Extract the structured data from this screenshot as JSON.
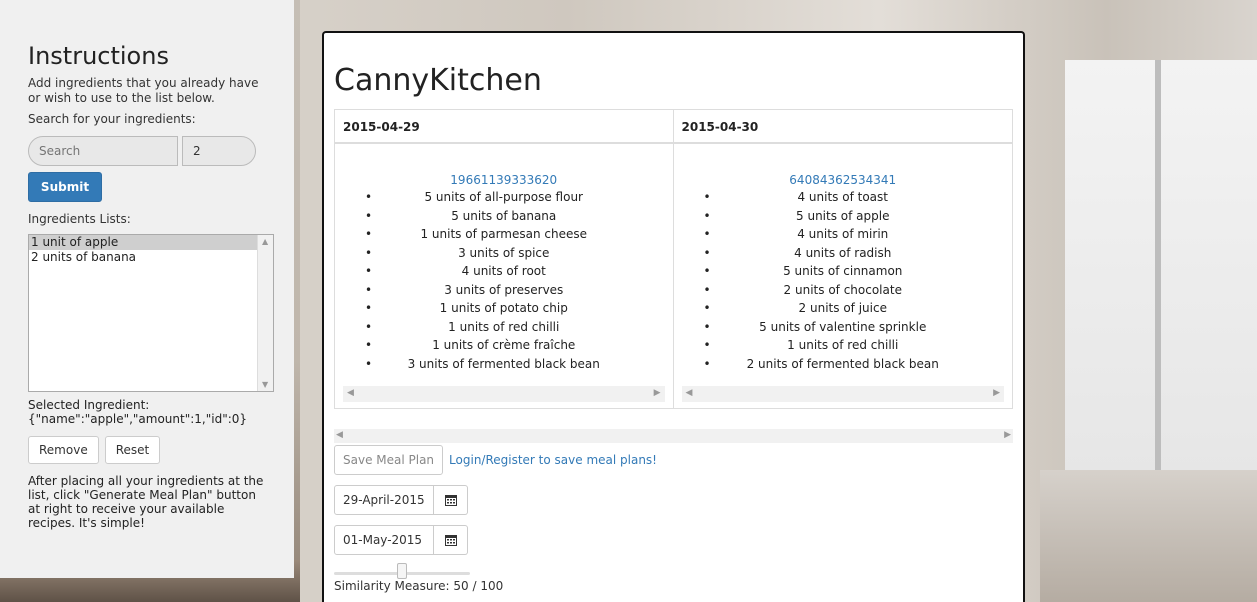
{
  "sidebar": {
    "title": "Instructions",
    "intro": "Add ingredients that you already have or wish to use to the list below.",
    "search_label": "Search for your ingredients:",
    "search_placeholder": "Search",
    "amount_value": "2",
    "submit_label": "Submit",
    "lists_label": "Ingredients Lists:",
    "ingredients": [
      "1 unit of apple",
      "2 units of banana"
    ],
    "selected_label": "Selected Ingredient:",
    "selected_value": "{\"name\":\"apple\",\"amount\":1,\"id\":0}",
    "remove_label": "Remove",
    "reset_label": "Reset",
    "after_text": "After placing all your ingredients at the list, click \"Generate Meal Plan\" button at right to receive your available recipes. It's simple!"
  },
  "main": {
    "title": "CannyKitchen",
    "days": [
      {
        "date": "2015-04-29",
        "recipe_id": "19661139333620",
        "items": [
          "5 units of all-purpose flour",
          "5 units of banana",
          "1 units of parmesan cheese",
          "3 units of spice",
          "4 units of root",
          "3 units of preserves",
          "1 units of potato chip",
          "1 units of red chilli",
          "1 units of crème fraîche",
          "3 units of fermented black bean"
        ]
      },
      {
        "date": "2015-04-30",
        "recipe_id": "64084362534341",
        "items": [
          "4 units of toast",
          "5 units of apple",
          "4 units of mirin",
          "4 units of radish",
          "5 units of cinnamon",
          "2 units of chocolate",
          "2 units of juice",
          "5 units of valentine sprinkle",
          "1 units of red chilli",
          "2 units of fermented black bean"
        ]
      }
    ],
    "save_label": "Save Meal Plan",
    "login_link": "Login/Register to save meal plans!",
    "start_date": "29-April-2015",
    "end_date": "01-May-2015",
    "similarity_label": "Similarity Measure: 50 / 100",
    "similarity_value": 50
  },
  "icons": {
    "calendar": "calendar-icon",
    "bullet": "•"
  },
  "colors": {
    "accent": "#337ab7",
    "panel_bg": "#f0f0f0"
  }
}
